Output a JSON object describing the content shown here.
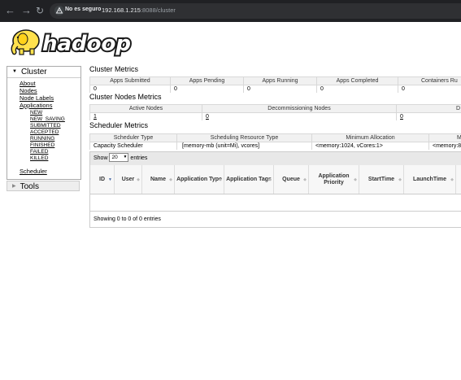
{
  "browser": {
    "security_label": "No es seguro",
    "url_host": "192.168.1.215",
    "url_path": ":8088/cluster"
  },
  "logo": {
    "text": "hadoop"
  },
  "sidebar": {
    "cluster_label": "Cluster",
    "items": [
      "About",
      "Nodes",
      "Node Labels",
      "Applications"
    ],
    "app_states": [
      "NEW",
      "NEW_SAVING",
      "SUBMITTED",
      "ACCEPTED",
      "RUNNING",
      "FINISHED",
      "FAILED",
      "KILLED"
    ],
    "scheduler_label": "Scheduler",
    "tools_label": "Tools"
  },
  "cluster_metrics": {
    "title": "Cluster Metrics",
    "headers": [
      "Apps Submitted",
      "Apps Pending",
      "Apps Running",
      "Apps Completed",
      "Containers Ru"
    ],
    "values": [
      "0",
      "0",
      "0",
      "0",
      "0"
    ]
  },
  "cluster_nodes_metrics": {
    "title": "Cluster Nodes Metrics",
    "headers": [
      "Active Nodes",
      "Decommissioning Nodes",
      "D"
    ],
    "values": [
      "1",
      "0",
      "0"
    ]
  },
  "scheduler_metrics": {
    "title": "Scheduler Metrics",
    "headers": [
      "Scheduler Type",
      "Scheduling Resource Type",
      "Minimum Allocation",
      "M"
    ],
    "values": [
      "Capacity Scheduler",
      "[memory-mb (unit=Mi), vcores]",
      "<memory:1024, vCores:1>",
      "<memory:8"
    ]
  },
  "apps_table": {
    "show_label": "Show",
    "entries_value": "20",
    "entries_label": "entries",
    "columns": [
      "ID",
      "User",
      "Name",
      "Application Type",
      "Application Tags",
      "Queue",
      "Application Priority",
      "StartTime",
      "LaunchTime"
    ],
    "info": "Showing 0 to 0 of 0 entries"
  },
  "colors": {
    "browser_bg": "#202124",
    "logo_yellow": "#ffe14d",
    "logo_blue": "#3b6fb6"
  }
}
